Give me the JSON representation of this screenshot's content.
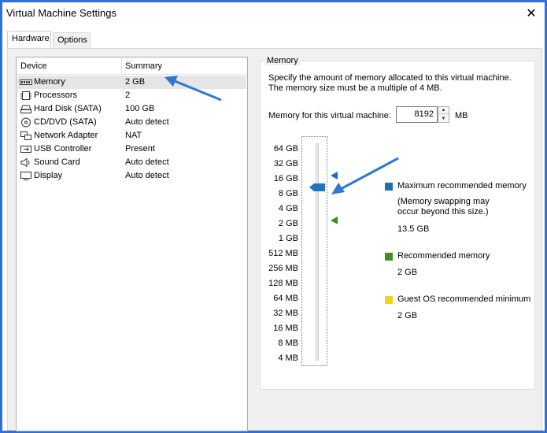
{
  "window": {
    "title": "Virtual Machine Settings",
    "close_glyph": "✕"
  },
  "tabs": [
    {
      "label": "Hardware",
      "active": true
    },
    {
      "label": "Options",
      "active": false
    }
  ],
  "device_list": {
    "header_device": "Device",
    "header_summary": "Summary",
    "items": [
      {
        "name": "Memory",
        "summary": "2 GB",
        "icon": "memory-icon",
        "selected": true
      },
      {
        "name": "Processors",
        "summary": "2",
        "icon": "processor-icon"
      },
      {
        "name": "Hard Disk (SATA)",
        "summary": "100 GB",
        "icon": "hard-disk-icon"
      },
      {
        "name": "CD/DVD (SATA)",
        "summary": "Auto detect",
        "icon": "cd-dvd-icon"
      },
      {
        "name": "Network Adapter",
        "summary": "NAT",
        "icon": "network-adapter-icon"
      },
      {
        "name": "USB Controller",
        "summary": "Present",
        "icon": "usb-icon"
      },
      {
        "name": "Sound Card",
        "summary": "Auto detect",
        "icon": "sound-icon"
      },
      {
        "name": "Display",
        "summary": "Auto detect",
        "icon": "display-icon"
      }
    ]
  },
  "memory": {
    "group_title": "Memory",
    "description_line1": "Specify the amount of memory allocated to this virtual machine.",
    "description_line2": "The memory size must be a multiple of 4 MB.",
    "field_label": "Memory for this virtual machine:",
    "value": "8192",
    "unit": "MB",
    "scale": [
      "64 GB",
      "32 GB",
      "16 GB",
      "8 GB",
      "4 GB",
      "2 GB",
      "1 GB",
      "512 MB",
      "256 MB",
      "128 MB",
      "64 MB",
      "32 MB",
      "16 MB",
      "8 MB",
      "4 MB"
    ],
    "slider_level_label": "8 GB",
    "legend": {
      "max_label": "Maximum recommended memory",
      "max_note_line1": "(Memory swapping may",
      "max_note_line2": "occur beyond this size.)",
      "max_value": "13.5 GB",
      "rec_label": "Recommended memory",
      "rec_value": "2 GB",
      "guest_label": "Guest OS recommended minimum",
      "guest_value": "2 GB"
    }
  },
  "colors": {
    "max_marker": "#1e6fb8",
    "recommended_marker": "#3f8f1f",
    "guest_marker": "#f2d21b",
    "annotation_arrow": "#2f78d1",
    "slider_thumb": "#1f73c4"
  }
}
